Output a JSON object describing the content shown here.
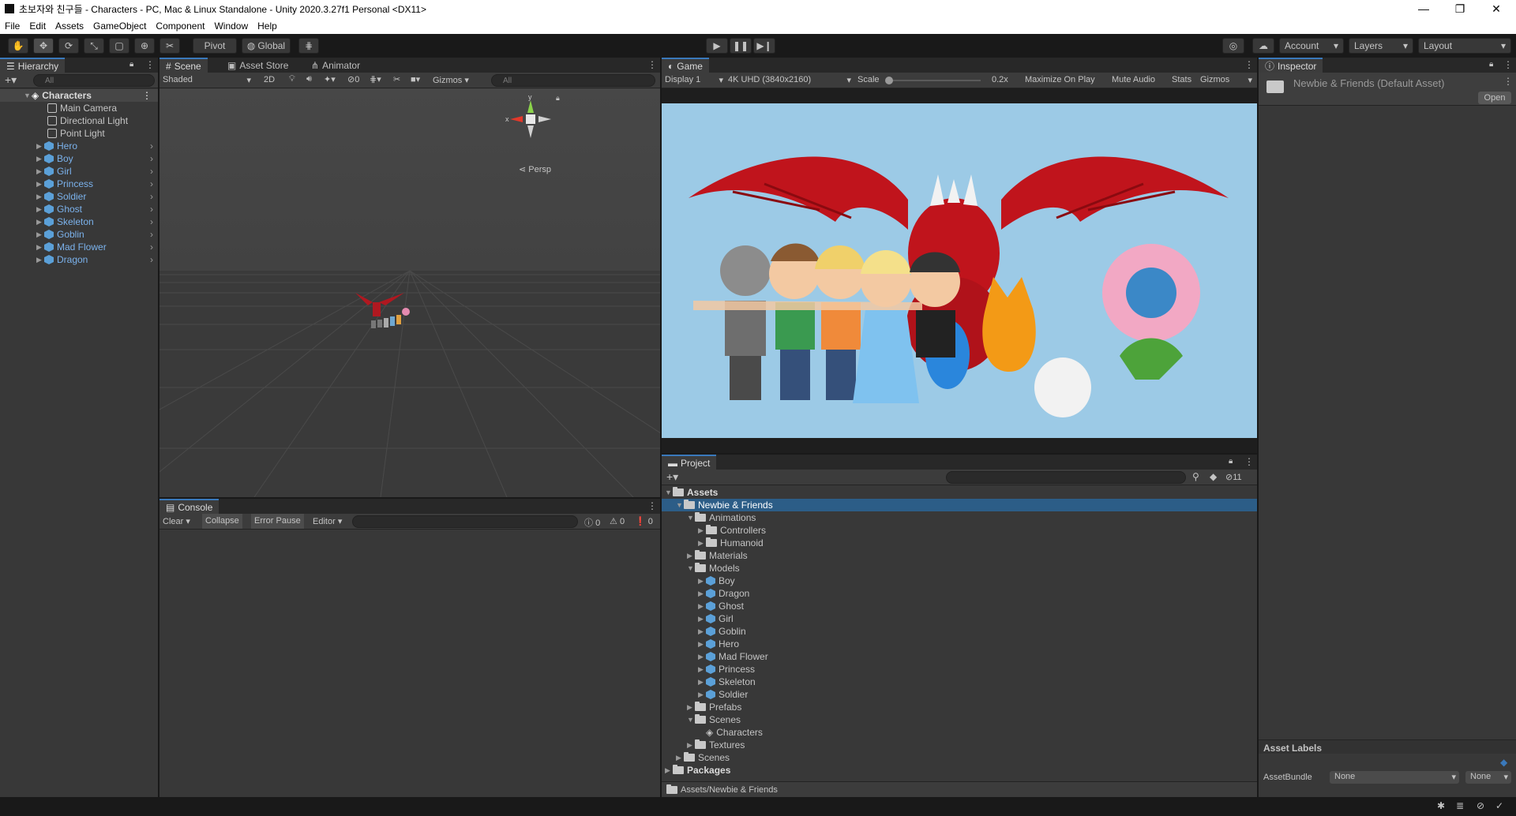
{
  "window": {
    "title": "초보자와 친구들 - Characters - PC, Mac & Linux Standalone - Unity 2020.3.27f1 Personal <DX11>",
    "minimize": "—",
    "restore": "❐",
    "close": "✕"
  },
  "menu": [
    "File",
    "Edit",
    "Assets",
    "GameObject",
    "Component",
    "Window",
    "Help"
  ],
  "toolbar": {
    "pivot": "Pivot",
    "global": "Global",
    "account": "Account",
    "layers": "Layers",
    "layout": "Layout"
  },
  "hierarchy": {
    "tab": "Hierarchy",
    "search_placeholder": "All",
    "scene": "Characters",
    "items": [
      "Main Camera",
      "Directional Light",
      "Point Light"
    ],
    "prefabs": [
      "Hero",
      "Boy",
      "Girl",
      "Princess",
      "Soldier",
      "Ghost",
      "Skeleton",
      "Goblin",
      "Mad Flower",
      "Dragon"
    ]
  },
  "scene": {
    "tabs": [
      "Scene",
      "Asset Store",
      "Animator"
    ],
    "shading": "Shaded",
    "mode2d": "2D",
    "hidden_count": "0",
    "gizmos": "Gizmos",
    "search_placeholder": "All",
    "persp": "Persp",
    "axis_x": "x",
    "axis_y": "y"
  },
  "game": {
    "tab": "Game",
    "display": "Display 1",
    "resolution": "4K UHD (3840x2160)",
    "scale_label": "Scale",
    "scale_value": "0.2x",
    "scale_fraction": 0.02,
    "maximize": "Maximize On Play",
    "mute": "Mute Audio",
    "stats": "Stats",
    "gizmos": "Gizmos"
  },
  "inspector": {
    "tab": "Inspector",
    "asset_name": "Newbie & Friends (Default Asset)",
    "open": "Open",
    "asset_labels": "Asset Labels",
    "assetbundle_label": "AssetBundle",
    "assetbundle_value": "None",
    "variant_value": "None"
  },
  "console": {
    "tab": "Console",
    "clear": "Clear",
    "collapse": "Collapse",
    "error_pause": "Error Pause",
    "editor": "Editor",
    "log_count": "0",
    "warn_count": "0",
    "error_count": "0"
  },
  "project": {
    "tab": "Project",
    "hidden_count": "11",
    "path": "Assets/Newbie & Friends",
    "tree": [
      {
        "label": "Assets",
        "depth": 0,
        "open": true,
        "bold": true,
        "type": "folder"
      },
      {
        "label": "Newbie & Friends",
        "depth": 1,
        "open": true,
        "type": "folder",
        "selected": true
      },
      {
        "label": "Animations",
        "depth": 2,
        "open": true,
        "type": "folder"
      },
      {
        "label": "Controllers",
        "depth": 3,
        "open": false,
        "type": "folder"
      },
      {
        "label": "Humanoid",
        "depth": 3,
        "open": false,
        "type": "folder"
      },
      {
        "label": "Materials",
        "depth": 2,
        "open": false,
        "type": "folder"
      },
      {
        "label": "Models",
        "depth": 2,
        "open": true,
        "type": "folder"
      },
      {
        "label": "Boy",
        "depth": 3,
        "open": false,
        "type": "model"
      },
      {
        "label": "Dragon",
        "depth": 3,
        "open": false,
        "type": "model"
      },
      {
        "label": "Ghost",
        "depth": 3,
        "open": false,
        "type": "model"
      },
      {
        "label": "Girl",
        "depth": 3,
        "open": false,
        "type": "model"
      },
      {
        "label": "Goblin",
        "depth": 3,
        "open": false,
        "type": "model"
      },
      {
        "label": "Hero",
        "depth": 3,
        "open": false,
        "type": "model"
      },
      {
        "label": "Mad Flower",
        "depth": 3,
        "open": false,
        "type": "model"
      },
      {
        "label": "Princess",
        "depth": 3,
        "open": false,
        "type": "model"
      },
      {
        "label": "Skeleton",
        "depth": 3,
        "open": false,
        "type": "model"
      },
      {
        "label": "Soldier",
        "depth": 3,
        "open": false,
        "type": "model"
      },
      {
        "label": "Prefabs",
        "depth": 2,
        "open": false,
        "type": "folder"
      },
      {
        "label": "Scenes",
        "depth": 2,
        "open": true,
        "type": "folder"
      },
      {
        "label": "Characters",
        "depth": 3,
        "open": null,
        "type": "scene"
      },
      {
        "label": "Textures",
        "depth": 2,
        "open": false,
        "type": "folder"
      },
      {
        "label": "Scenes",
        "depth": 1,
        "open": false,
        "type": "folder"
      },
      {
        "label": "Packages",
        "depth": 0,
        "open": false,
        "bold": true,
        "type": "folder"
      }
    ]
  },
  "colors": {
    "selection": "#2c5d87",
    "accent": "#3a79bb",
    "game_sky": "#9ccae6",
    "dragon": "#c0141c"
  }
}
